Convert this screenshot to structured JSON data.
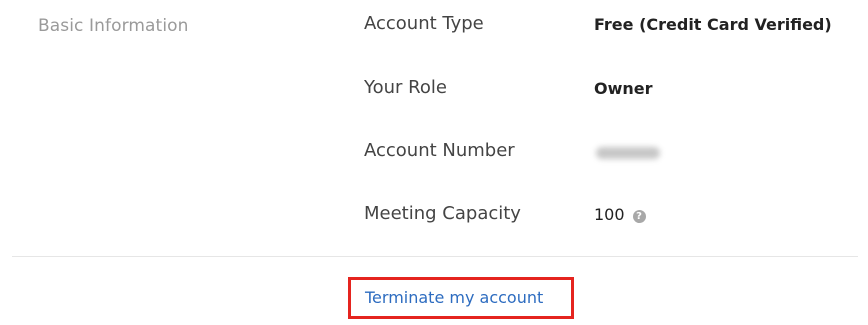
{
  "section": {
    "title": "Basic Information"
  },
  "rows": [
    {
      "label": "Account Type",
      "value": "Free (Credit Card Verified)"
    },
    {
      "label": "Your Role",
      "value": "Owner"
    },
    {
      "label": "Account Number",
      "value": "",
      "blurred": true
    },
    {
      "label": "Meeting Capacity",
      "value": "100",
      "help_icon": "question-circle-icon"
    }
  ],
  "actions": {
    "terminate_label": "Terminate my account",
    "highlight_color": "#e5241f",
    "link_color": "#2d6cc0"
  }
}
